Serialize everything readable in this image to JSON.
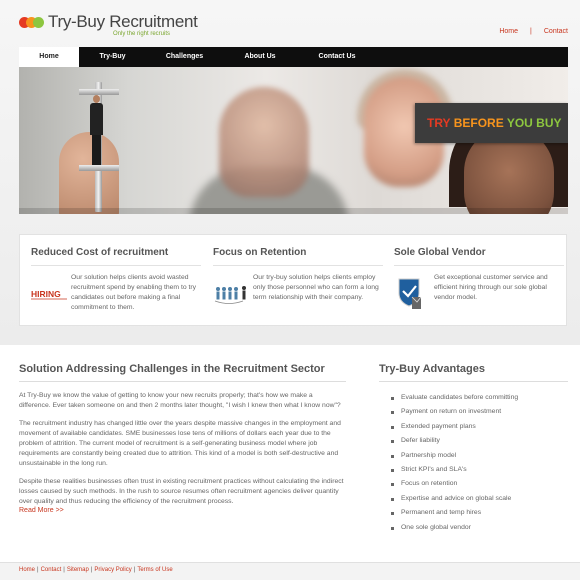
{
  "brand": {
    "name_part1": "Try-",
    "name_part2": "Buy Recruitment",
    "tagline": "Only the right recruits",
    "dot_colors": [
      "#e53a22",
      "#f7941d",
      "#8dc63f"
    ]
  },
  "toplinks": {
    "home": "Home",
    "separator": "|",
    "contact": "Contact"
  },
  "nav": [
    "Home",
    "Try-Buy",
    "Challenges",
    "About Us",
    "Contact Us"
  ],
  "hero": {
    "badge": {
      "word1": "TRY",
      "word2": "BEFORE",
      "word3": "YOU BUY"
    }
  },
  "features": [
    {
      "title": "Reduced Cost of recruitment",
      "icon": "hiring-icon",
      "icon_text": "HIRING",
      "text": "Our solution helps clients avoid wasted recruitment spend by enabling them to try candidates out before making a final commitment to them."
    },
    {
      "title": "Focus on Retention",
      "icon": "team-retention-icon",
      "text": "Our try-buy solution helps clients employ only those personnel who can form a long term relationship with their company."
    },
    {
      "title": "Sole Global Vendor",
      "icon": "shield-check-icon",
      "text": "Get exceptional customer service and efficient hiring through our sole global vendor model."
    }
  ],
  "solution": {
    "title": "Solution Addressing Challenges in the Recruitment Sector",
    "p1": "At Try-Buy we know the value of getting to know your new recruits properly; that's how we make a difference. Ever taken someone on and then 2 months later thought, \"I wish I knew then what I know now\"?",
    "p2": "The recruitment industry has changed little over the years despite massive changes in the employment and movement of available candidates. SME businesses lose tens of millions of dollars each year due to the problem of attrition. The current model of recruitment is a self-generating business model where job requirements are constantly being created due to attrition. This kind of a model is both self-destructive and unsustainable in the long run.",
    "p3": "Despite these realities businesses often trust in existing recruitment practices without calculating the indirect losses caused by such methods. In the rush to source resumes often recruitment agencies deliver quantity over quality and thus reducing the efficiency of the recruitment process.",
    "read_more": "Read More >>"
  },
  "advantages": {
    "title": "Try-Buy Advantages",
    "items": [
      "Evaluate candidates before committing",
      "Payment on return on investment",
      "Extended payment plans",
      "Defer liability",
      "Partnership model",
      "Strict KPI's and SLA's",
      "Focus on retention",
      "Expertise and advice on global scale",
      "Permanent and temp hires",
      "One sole global vendor"
    ]
  },
  "footer": {
    "links": [
      "Home",
      "Contact",
      "Sitemap",
      "Privacy Policy",
      "Terms of Use"
    ],
    "separator": "|"
  }
}
